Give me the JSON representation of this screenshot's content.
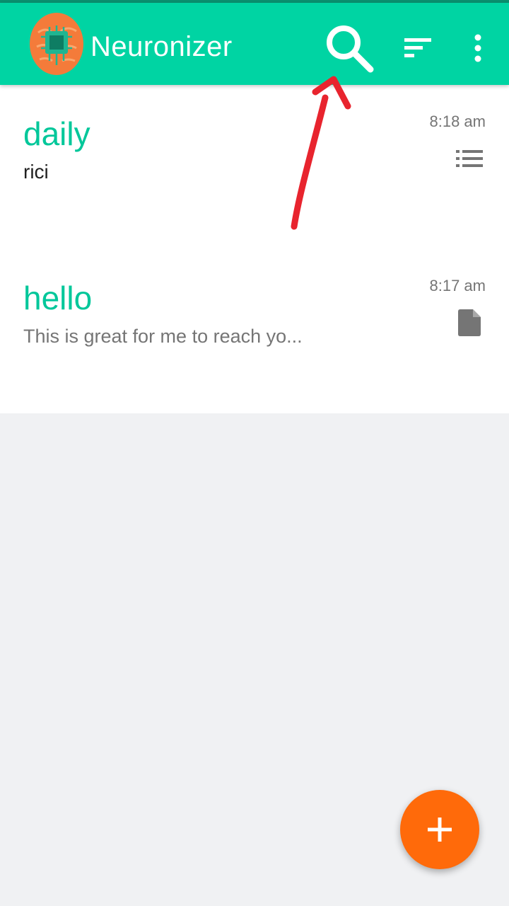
{
  "app_bar": {
    "title": "Neuronizer",
    "background": "#00d4a3",
    "logo_icon": "brain-chip-icon",
    "actions": [
      {
        "name": "search",
        "icon": "search-icon"
      },
      {
        "name": "sort",
        "icon": "sort-icon"
      },
      {
        "name": "more",
        "icon": "more-vert-icon"
      }
    ]
  },
  "notes": [
    {
      "title": "daily",
      "snippet": "rici",
      "time": "8:18 am",
      "type_icon": "checklist-icon"
    },
    {
      "title": "hello",
      "snippet": "This is great for me to reach yo...",
      "time": "8:17 am",
      "type_icon": "note-file-icon"
    }
  ],
  "fab": {
    "icon": "plus-icon",
    "color": "#ff6a0a"
  },
  "colors": {
    "accent": "#00c79a",
    "annotation": "#e8242e"
  }
}
